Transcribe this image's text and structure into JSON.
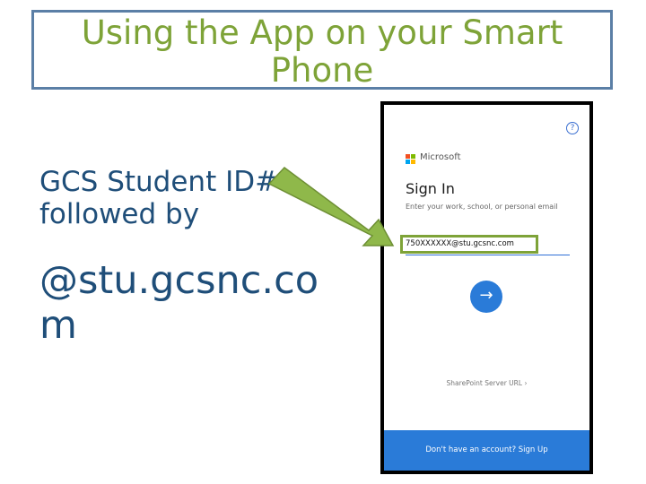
{
  "slide": {
    "title": "Using the App on your Smart Phone",
    "text1": "GCS Student ID# followed by",
    "text2": "@stu.gcsnc.com"
  },
  "phone": {
    "help_icon": "?",
    "brand": "Microsoft",
    "signin_title": "Sign In",
    "signin_subtitle": "Enter your work, school, or personal email",
    "email_value": "750XXXXXX@stu.gcsnc.com",
    "next_icon": "arrow-right-icon",
    "sharepoint_link": "SharePoint Server URL",
    "signup_text": "Don't have an account? Sign Up"
  },
  "colors": {
    "title_green": "#7ea338",
    "body_blue": "#1f4e79",
    "accent_blue": "#2a7bd8",
    "arrow_green": "#8fb84a"
  }
}
